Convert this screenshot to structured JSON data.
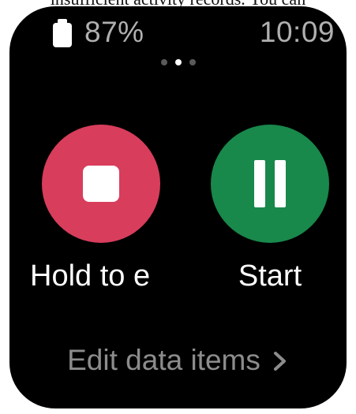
{
  "caption": {
    "text": "insufficient activity records. You can"
  },
  "status_bar": {
    "battery_percent": "87%",
    "time": "10:09"
  },
  "pager": {
    "page_count": 3,
    "active_index": 1
  },
  "controls": {
    "end": {
      "label": "Hold to e",
      "icon": "stop-icon",
      "color": "#d83d5c"
    },
    "start": {
      "label": "Start",
      "icon": "pause-icon",
      "color": "#18884b"
    }
  },
  "edit_link": {
    "label": "Edit data items",
    "icon": "chevron-right-icon"
  },
  "colors": {
    "background": "#000000",
    "status_text": "#b0b0b0",
    "edit_text": "#8c8c8c",
    "inactive_dot": "#5a5a5a",
    "active_dot": "#ffffff"
  }
}
